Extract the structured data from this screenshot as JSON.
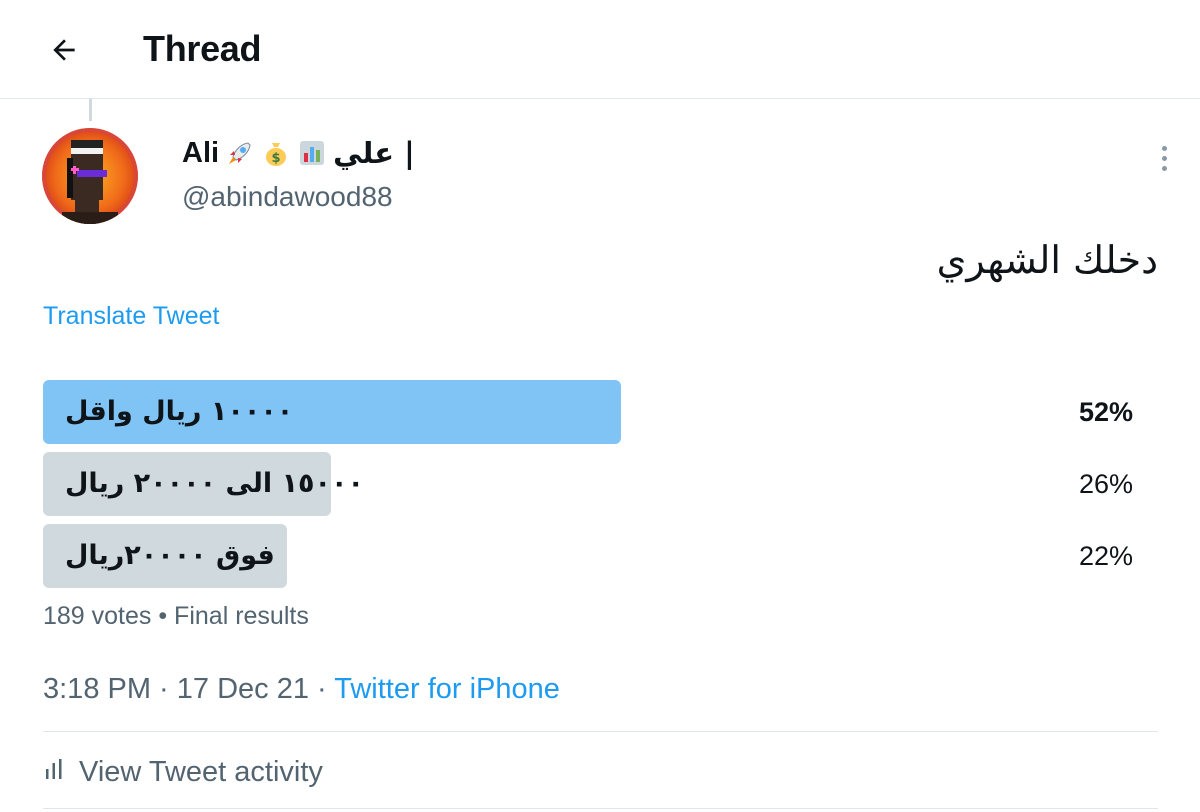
{
  "header": {
    "title": "Thread"
  },
  "tweet": {
    "author_name": "Ali",
    "author_name_suffix": "| علي",
    "name_emojis": [
      "rocket-emoji",
      "money-bag-emoji",
      "bar-chart-emoji"
    ],
    "handle": "@abindawood88",
    "text": "دخلك الشهري",
    "translate_label": "Translate Tweet"
  },
  "poll": {
    "options": [
      {
        "label": "١٠٠٠٠ ريال واقل",
        "percent": 52,
        "percent_label": "52%",
        "winner": true
      },
      {
        "label": "١٥٠٠٠ الى ٢٠٠٠٠ ريال",
        "percent": 26,
        "percent_label": "26%",
        "winner": false
      },
      {
        "label": "فوق ٢٠٠٠٠ريال",
        "percent": 22,
        "percent_label": "22%",
        "winner": false
      }
    ],
    "votes_text": "189 votes • Final results"
  },
  "meta": {
    "time": "3:18 PM",
    "separator": " · ",
    "date": "17 Dec 21",
    "source": "Twitter for iPhone"
  },
  "activity": {
    "label": "View Tweet activity"
  },
  "colors": {
    "accent": "#1d9bf0",
    "winner_bar": "#7fc4f5",
    "loser_bar": "#cfd9de",
    "secondary_text": "#536471"
  }
}
